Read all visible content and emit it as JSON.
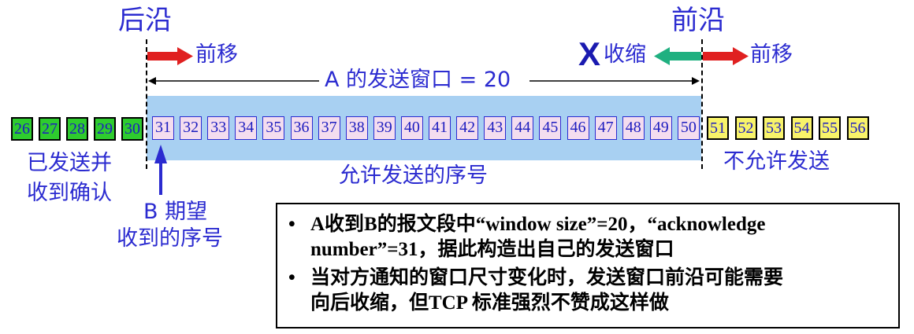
{
  "labels": {
    "trailing_edge": "后沿",
    "leading_edge": "前沿",
    "move_forward_left": "前移",
    "move_forward_right": "前移",
    "shrink": "收缩",
    "shrink_mark": "X",
    "window_label": "A 的发送窗口 = 20",
    "sent_acked_1": "已发送并",
    "sent_acked_2": "收到确认",
    "allowed": "允许发送的序号",
    "not_allowed": "不允许发送",
    "expect_1": "B 期望",
    "expect_2": "收到的序号"
  },
  "sequence": {
    "acked": [
      "26",
      "27",
      "28",
      "29",
      "30"
    ],
    "window": [
      "31",
      "32",
      "33",
      "34",
      "35",
      "36",
      "37",
      "38",
      "39",
      "40",
      "41",
      "42",
      "43",
      "44",
      "45",
      "46",
      "47",
      "48",
      "49",
      "50"
    ],
    "blocked": [
      "51",
      "52",
      "53",
      "54",
      "55",
      "56"
    ]
  },
  "notes": {
    "bullet": "•",
    "line1": "A收到B的报文段中“window size”=20，“acknowledge",
    "line2": "number”=31，据此构造出自己的发送窗口",
    "line3": "当对方通知的窗口尺寸变化时，发送窗口前沿可能需要",
    "line4": "向后收缩，但TCP 标准强烈不赞成这样做"
  },
  "colors": {
    "acked_box": "#2ecc2e",
    "window_box": "#f4ddef",
    "blocked_box": "#f8f36a",
    "window_band": "#a8d0f2",
    "forward_arrow": "#e02020",
    "shrink_arrow": "#20b080",
    "label_text": "#2b2bd0"
  }
}
